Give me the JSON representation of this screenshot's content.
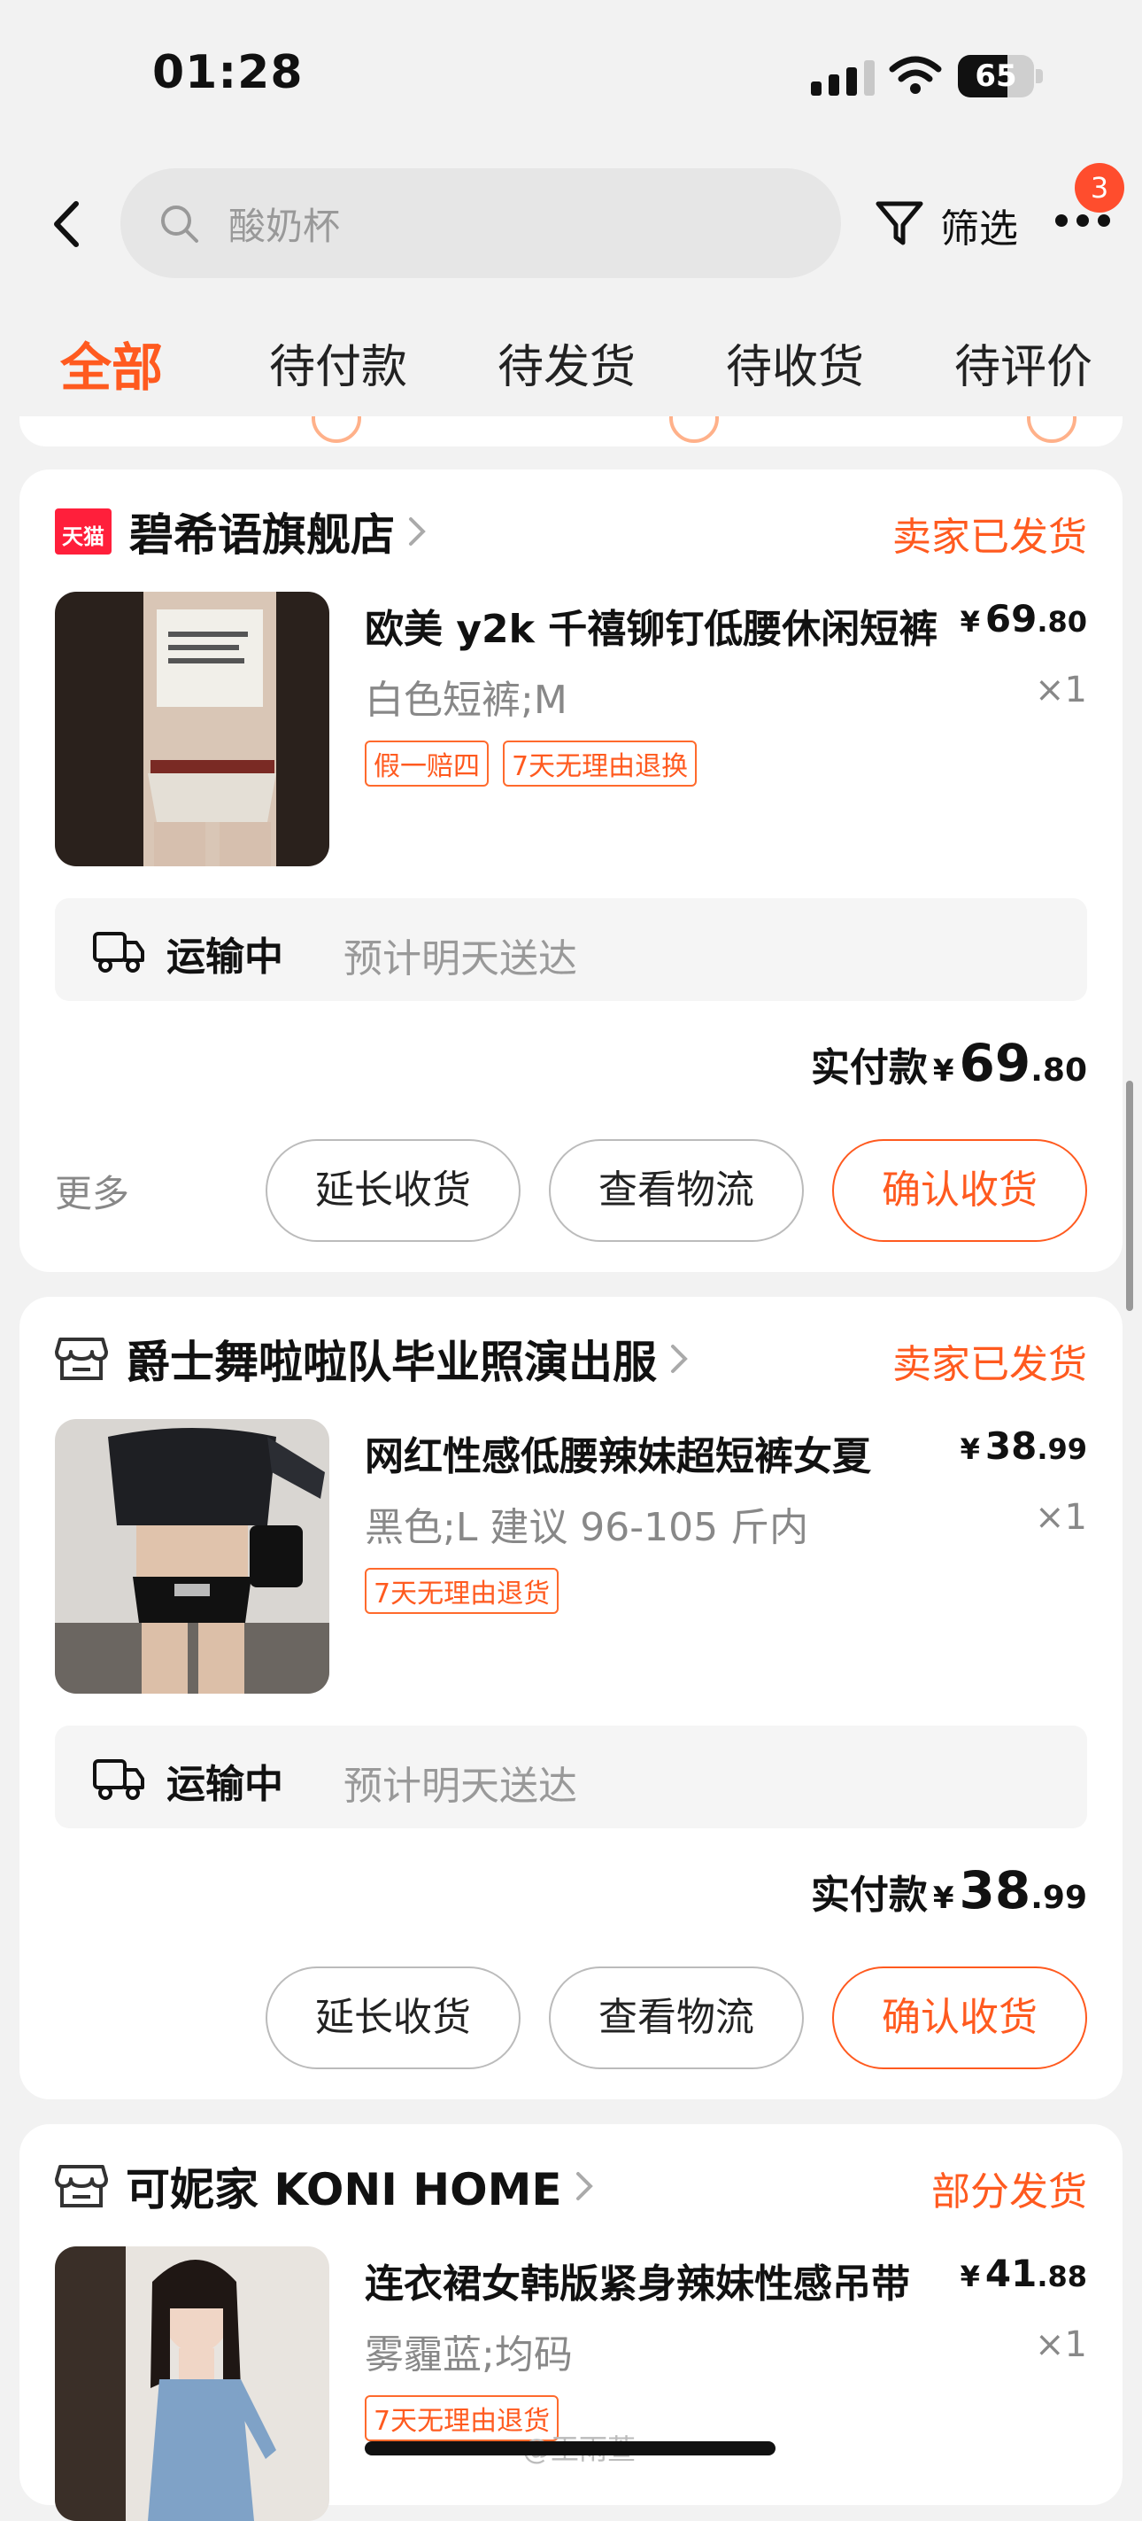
{
  "status_bar": {
    "time": "01:28",
    "battery": "65",
    "battery_level_pct": 65
  },
  "search": {
    "placeholder": "酸奶杯"
  },
  "toolbar": {
    "filter_label": "筛选",
    "more_badge": "3"
  },
  "tabs": [
    {
      "label": "全部",
      "active": true
    },
    {
      "label": "待付款",
      "active": false
    },
    {
      "label": "待发货",
      "active": false
    },
    {
      "label": "待收货",
      "active": false
    },
    {
      "label": "待评价",
      "active": false
    }
  ],
  "orders": [
    {
      "shop": "碧希语旗舰店",
      "shop_badge": "天猫",
      "status": "卖家已发货",
      "title": "欧美 y2k 千禧铆钉低腰休闲短裤",
      "price_yen": "¥",
      "price_int": "69",
      "price_dec": ".80",
      "sku": "白色短裤;M",
      "qty": "×1",
      "tags": [
        "假一赔四",
        "7天无理由退换"
      ],
      "logistics_status": "运输中",
      "logistics_eta": "预计明天送达",
      "paid_label": "实付款",
      "paid_int": "69",
      "paid_dec": ".80",
      "more_label": "更多",
      "buttons": [
        "延长收货",
        "查看物流",
        "确认收货"
      ]
    },
    {
      "shop": "爵士舞啦啦队毕业照演出服",
      "status": "卖家已发货",
      "title": "网红性感低腰辣妹超短裤女夏",
      "price_yen": "¥",
      "price_int": "38",
      "price_dec": ".99",
      "sku": "黑色;L 建议 96-105 斤内",
      "qty": "×1",
      "tags": [
        "7天无理由退货"
      ],
      "logistics_status": "运输中",
      "logistics_eta": "预计明天送达",
      "paid_label": "实付款",
      "paid_int": "38",
      "paid_dec": ".99",
      "buttons": [
        "延长收货",
        "查看物流",
        "确认收货"
      ]
    },
    {
      "shop": "可妮家 KONI HOME",
      "status": "部分发货",
      "title": "连衣裙女韩版紧身辣妹性感吊带",
      "price_yen": "¥",
      "price_int": "41",
      "price_dec": ".88",
      "sku": "雾霾蓝;均码",
      "qty": "×1",
      "tags": [
        "7天无理由退货"
      ]
    }
  ],
  "watermark": "@王雨萱"
}
